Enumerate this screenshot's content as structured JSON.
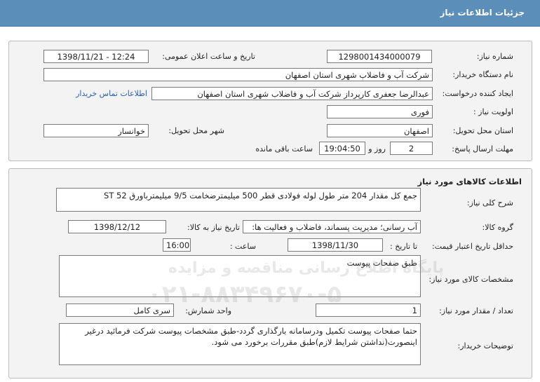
{
  "header": {
    "title": "جزئیات اطلاعات نیاز"
  },
  "labels": {
    "need_number": "شماره نیاز:",
    "announce_datetime": "تاریخ و ساعت اعلان عمومی:",
    "buyer_org": "نام دستگاه خریدار:",
    "creator": "ایجاد کننده درخواست:",
    "priority": "اولویت نیاز :",
    "delivery_province": "استان محل تحویل:",
    "delivery_city": "شهر محل تحویل:",
    "reply_deadline": "مهلت ارسال پاسخ:",
    "day_and": "روز و",
    "time_remaining": "ساعت باقی مانده",
    "section_title": "اطلاعات کالاهای مورد نیاز",
    "overall_desc": "شرح کلی نیاز:",
    "goods_group": "گروه کالا:",
    "need_date_goods": "تاریخ نیاز به کالا:",
    "min_price_validity": "حداقل تاریخ اعتبار قیمت:",
    "until_date": "تا تاریخ :",
    "hour": "ساعت :",
    "goods_specs": "مشخصات کالای مورد نیاز:",
    "quantity": "تعداد / مقدار مورد نیاز:",
    "unit": "واحد شمارش:",
    "buyer_notes": "توضیحات خریدار:"
  },
  "values": {
    "need_number": "1298001434000079",
    "announce_datetime": "1398/11/21 - 12:24",
    "buyer_org": "شرکت آب و فاضلاب شهری استان اصفهان",
    "creator": "عبدالرضا جعفری کارپرداز شرکت آب و فاضلاب شهری استان اصفهان",
    "contact_link": "اطلاعات تماس خریدار",
    "priority": "فوری",
    "delivery_province": "اصفهان",
    "delivery_city": "خوانسار",
    "deadline_days": "2",
    "deadline_time": "19:04:50",
    "overall_desc": "جمع کل مقدار 204 متر طول  لوله فولادی قطر  500 میلیمترضخامت 9/5 میلیمترباورق  ST 52",
    "goods_group": "آب رسانی؛ مدیریت پسماند، فاضلاب و فعالیت ها:",
    "need_date_goods": "1398/12/12",
    "price_validity_date": "1398/11/30",
    "price_validity_hour": "16:00",
    "goods_specs": "طبق صفحات پیوست",
    "quantity": "1",
    "unit": "سری کامل",
    "buyer_notes": "حتما صفحات پیوست تکمیل ودرسامانه بارگذاری گردد-طبق مشخصات پیوست شرکت فرمائید درغیر اینصورت(نداشتن شرایط لازم)طبق مقررات برخورد می شود."
  },
  "watermark": {
    "line1": "پایگاه اطلاع رسانی مناقصه و مزایده",
    "line2": "۰۲۱-۸۸۳۴۹۶۷۰-۵"
  }
}
